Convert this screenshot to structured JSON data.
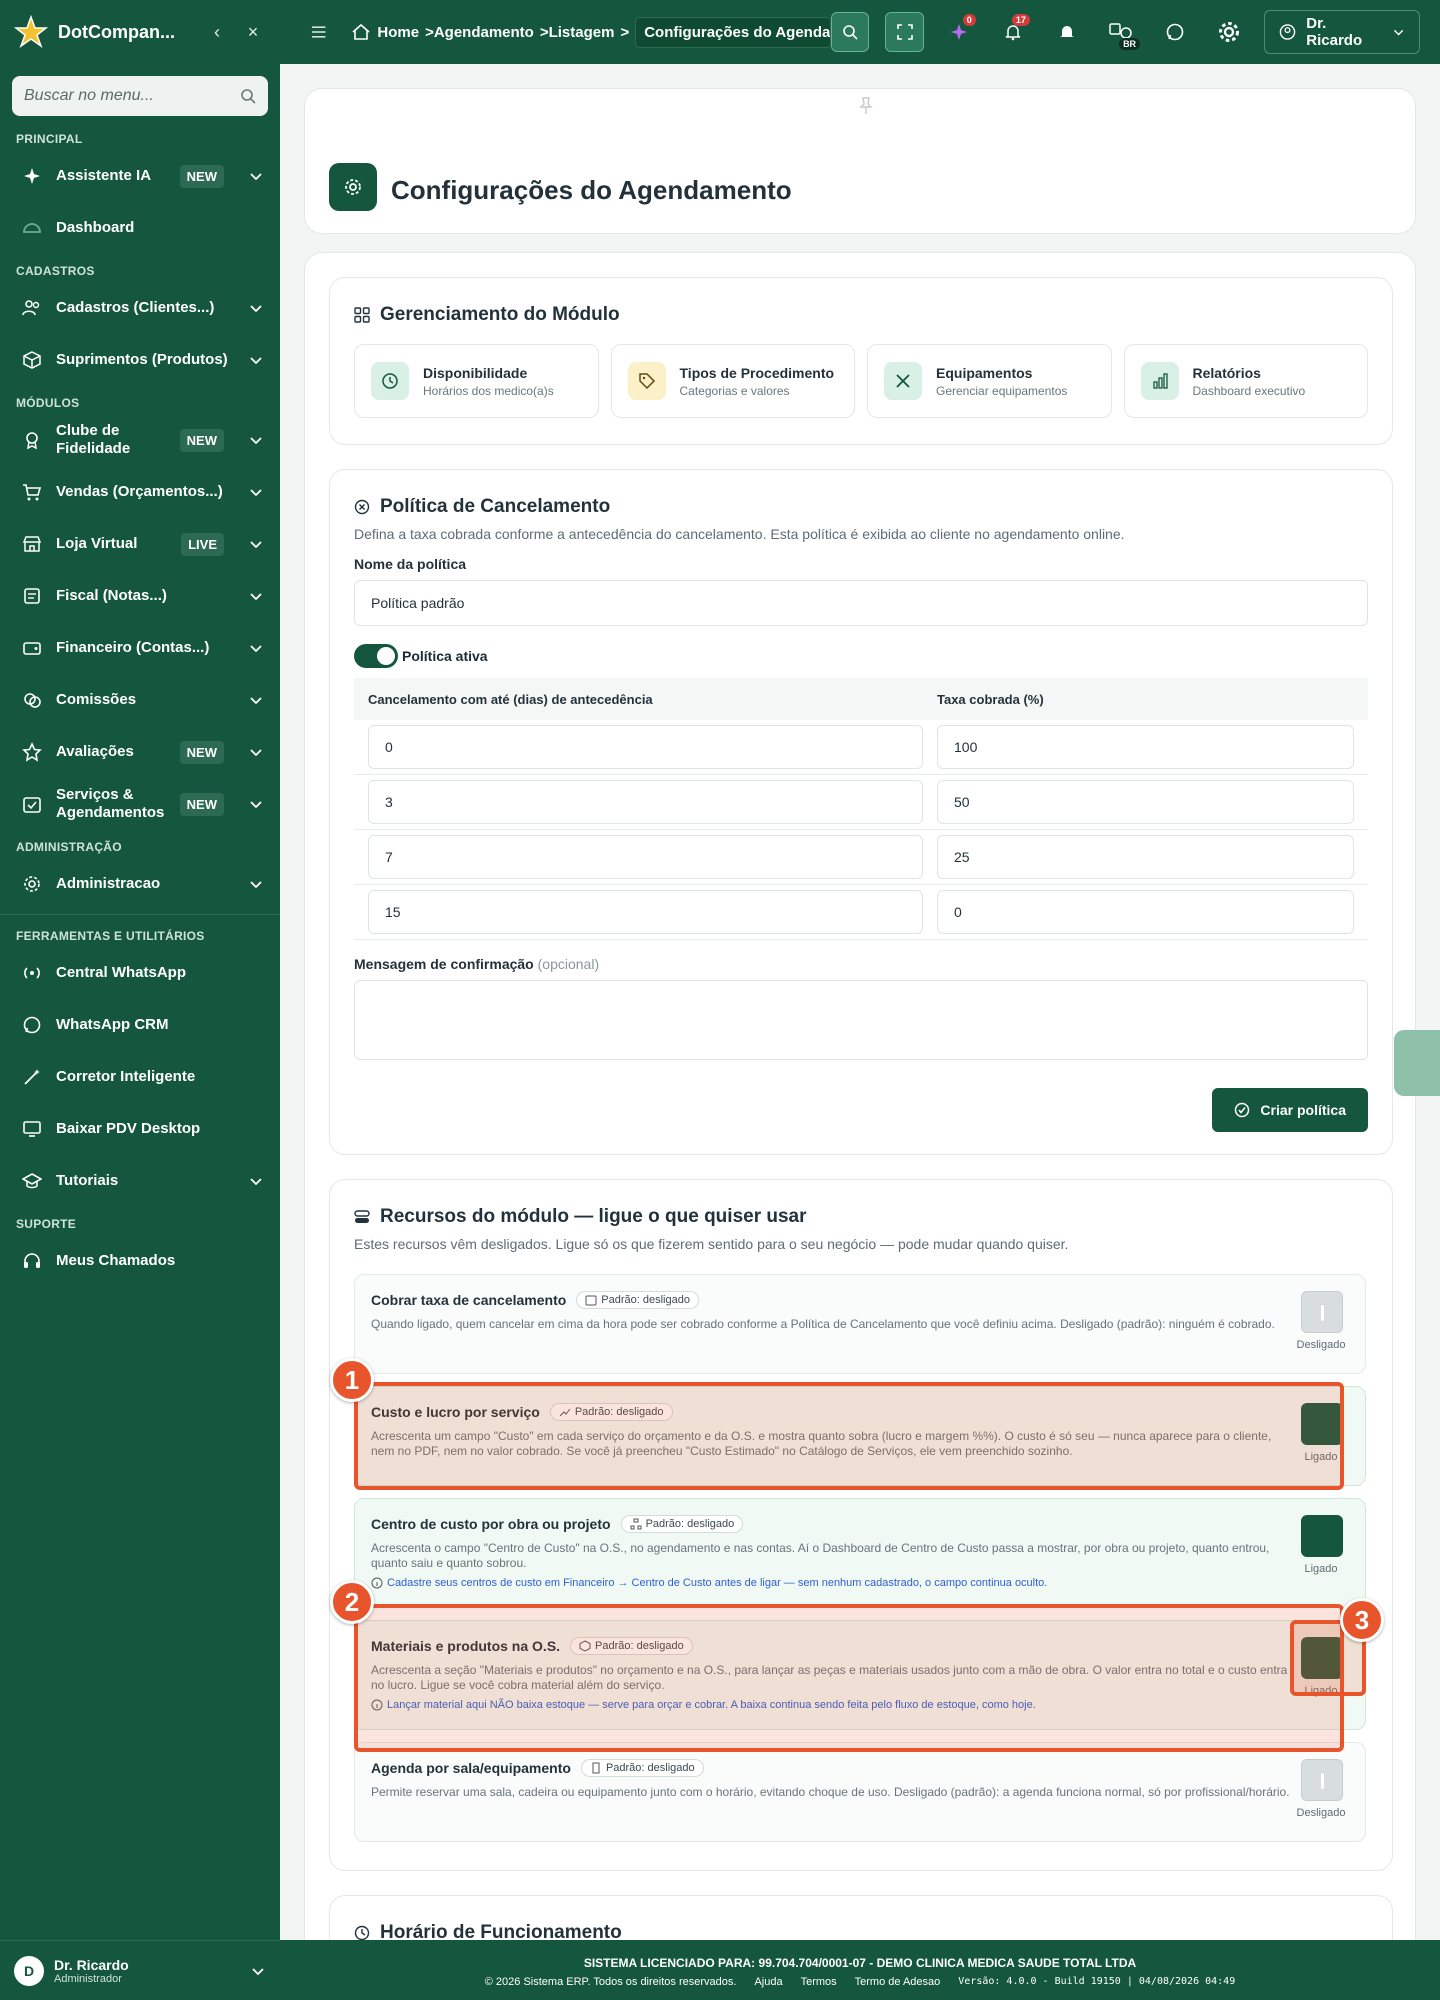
{
  "sidebar": {
    "brand": "DotCompan...",
    "search_placeholder": "Buscar no menu...",
    "sections": {
      "principal": "PRINCIPAL",
      "cadastros": "CADASTROS",
      "modulos": "MÓDULOS",
      "administracao": "ADMINISTRAÇÃO",
      "ferramentas": "FERRAMENTAS E UTILITÁRIOS",
      "suporte": "SUPORTE"
    },
    "items": {
      "assistente": "Assistente IA",
      "dashboard": "Dashboard",
      "cadastros": "Cadastros (Clientes...)",
      "suprimentos": "Suprimentos (Produtos)",
      "clube": "Clube de Fidelidade",
      "vendas": "Vendas (Orçamentos...)",
      "loja": "Loja Virtual",
      "fiscal": "Fiscal (Notas...)",
      "financeiro": "Financeiro (Contas...)",
      "comissoes": "Comissões",
      "avaliacoes": "Avaliações",
      "servicos": "Serviços & Agendamentos",
      "administracao": "Administracao",
      "whatsapp_central": "Central WhatsApp",
      "whatsapp_crm": "WhatsApp CRM",
      "corretor": "Corretor Inteligente",
      "pdv": "Baixar PDV Desktop",
      "tutoriais": "Tutoriais",
      "chamados": "Meus Chamados"
    },
    "badges": {
      "new": "NEW",
      "live": "LIVE"
    },
    "user": {
      "initial": "D",
      "name": "Dr. Ricardo",
      "role": "Administrador"
    }
  },
  "topbar": {
    "crumbs": [
      "Home",
      ">Agendamento",
      ">Listagem",
      ">"
    ],
    "crumb_active": "Configurações do Agendam",
    "badge_ai": "0",
    "badge_notif": "17",
    "lang": "BR",
    "user": "Dr. Ricardo"
  },
  "page": {
    "title": "Configurações do Agendamento"
  },
  "modulo": {
    "title": "Gerenciamento do Módulo",
    "cards": [
      {
        "title": "Disponibilidade",
        "sub": "Horários dos medico(a)s"
      },
      {
        "title": "Tipos de Procedimento",
        "sub": "Categorias e valores"
      },
      {
        "title": "Equipamentos",
        "sub": "Gerenciar equipamentos"
      },
      {
        "title": "Relatórios",
        "sub": "Dashboard executivo"
      }
    ]
  },
  "politica": {
    "title": "Política de Cancelamento",
    "subtitle": "Defina a taxa cobrada conforme a antecedência do cancelamento. Esta política é exibida ao cliente no agendamento online.",
    "name_label": "Nome da política",
    "name_value": "Política padrão",
    "active_label": "Política ativa",
    "col_days": "Cancelamento com até (dias) de antecedência",
    "col_fee": "Taxa cobrada (%)",
    "rows": [
      {
        "days": "0",
        "fee": "100"
      },
      {
        "days": "3",
        "fee": "50"
      },
      {
        "days": "7",
        "fee": "25"
      },
      {
        "days": "15",
        "fee": "0"
      }
    ],
    "msg_label": "Mensagem de confirmação",
    "msg_optional": "(opcional)",
    "create_btn": "Criar política"
  },
  "recursos": {
    "title": "Recursos do módulo — ligue o que quiser usar",
    "subtitle": "Estes recursos vêm desligados. Ligue só os que fizerem sentido para o seu negócio — pode mudar quando quiser.",
    "default_pill": "Padrão: desligado",
    "items": [
      {
        "title": "Cobrar taxa de cancelamento",
        "desc": "Quando ligado, quem cancelar em cima da hora pode ser cobrado conforme a Política de Cancelamento que você definiu acima. Desligado (padrão): ninguém é cobrado.",
        "note": "",
        "state": "Desligado"
      },
      {
        "title": "Custo e lucro por serviço",
        "desc": "Acrescenta um campo \"Custo\" em cada serviço do orçamento e da O.S. e mostra quanto sobra (lucro e margem %%). O custo é só seu — nunca aparece para o cliente, nem no PDF, nem no valor cobrado. Se você já preencheu \"Custo Estimado\" no Catálogo de Serviços, ele vem preenchido sozinho.",
        "note": "",
        "state": "Ligado"
      },
      {
        "title": "Centro de custo por obra ou projeto",
        "desc": "Acrescenta o campo \"Centro de Custo\" na O.S., no agendamento e nas contas. Aí o Dashboard de Centro de Custo passa a mostrar, por obra ou projeto, quanto entrou, quanto saiu e quanto sobrou.",
        "note": "Cadastre seus centros de custo em Financeiro → Centro de Custo antes de ligar — sem nenhum cadastrado, o campo continua oculto.",
        "state": "Ligado"
      },
      {
        "title": "Materiais e produtos na O.S.",
        "desc": "Acrescenta a seção \"Materiais e produtos\" no orçamento e na O.S., para lançar as peças e materiais usados junto com a mão de obra. O valor entra no total e o custo entra no lucro. Ligue se você cobra material além do serviço.",
        "note": "Lançar material aqui NÃO baixa estoque — serve para orçar e cobrar. A baixa continua sendo feita pelo fluxo de estoque, como hoje.",
        "state": "Ligado"
      },
      {
        "title": "Agenda por sala/equipamento",
        "desc": "Permite reservar uma sala, cadeira ou equipamento junto com o horário, evitando choque de uso. Desligado (padrão): a agenda funciona normal, só por profissional/horário.",
        "note": "",
        "state": "Desligado"
      }
    ]
  },
  "horario": {
    "title": "Horário de Funcionamento"
  },
  "annotations": [
    "1",
    "2",
    "3"
  ],
  "footer": {
    "license_label": "SISTEMA LICENCIADO PARA:",
    "license_value": "99.704.704/0001-07 - DEMO CLINICA MEDICA SAUDE TOTAL LTDA",
    "copyright": "© 2026 Sistema ERP. Todos os direitos reservados.",
    "links": [
      "Ajuda",
      "Termos",
      "Termo de Adesao"
    ],
    "version": "Versão: 4.0.0 - Build 19150 | 04/08/2026 04:49"
  },
  "colors": {
    "brand": "#14573e",
    "annotation": "#e8542b",
    "link": "#2f5fd1"
  }
}
